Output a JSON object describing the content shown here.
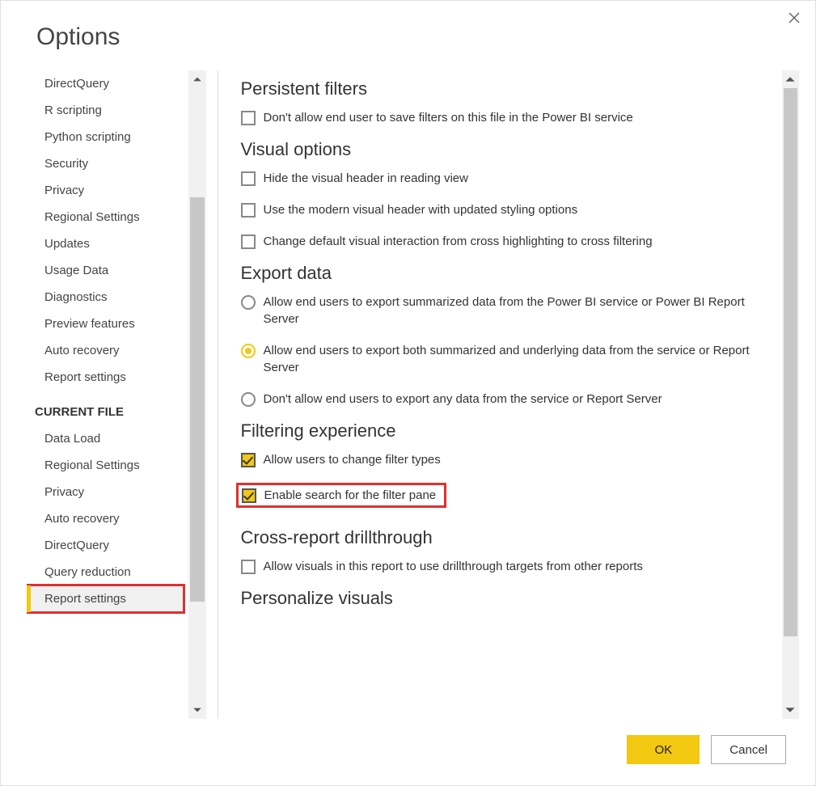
{
  "title": "Options",
  "buttons": {
    "ok": "OK",
    "cancel": "Cancel"
  },
  "sidebar": {
    "items_top": [
      "DirectQuery",
      "R scripting",
      "Python scripting",
      "Security",
      "Privacy",
      "Regional Settings",
      "Updates",
      "Usage Data",
      "Diagnostics",
      "Preview features",
      "Auto recovery",
      "Report settings"
    ],
    "section_header": "CURRENT FILE",
    "items_bottom": [
      "Data Load",
      "Regional Settings",
      "Privacy",
      "Auto recovery",
      "DirectQuery",
      "Query reduction",
      "Report settings"
    ],
    "selected_bottom_index": 6
  },
  "sections": {
    "persistent": {
      "title": "Persistent filters",
      "opt1": "Don't allow end user to save filters on this file in the Power BI service"
    },
    "visual": {
      "title": "Visual options",
      "opt1": "Hide the visual header in reading view",
      "opt2": "Use the modern visual header with updated styling options",
      "opt3": "Change default visual interaction from cross highlighting to cross filtering"
    },
    "export": {
      "title": "Export data",
      "opt1": "Allow end users to export summarized data from the Power BI service or Power BI Report Server",
      "opt2": "Allow end users to export both summarized and underlying data from the service or Report Server",
      "opt3": "Don't allow end users to export any data from the service or Report Server",
      "selected_index": 1
    },
    "filtering": {
      "title": "Filtering experience",
      "opt1": "Allow users to change filter types",
      "opt2": "Enable search for the filter pane"
    },
    "crossreport": {
      "title": "Cross-report drillthrough",
      "opt1": "Allow visuals in this report to use drillthrough targets from other reports"
    },
    "personalize": {
      "title": "Personalize visuals"
    }
  }
}
